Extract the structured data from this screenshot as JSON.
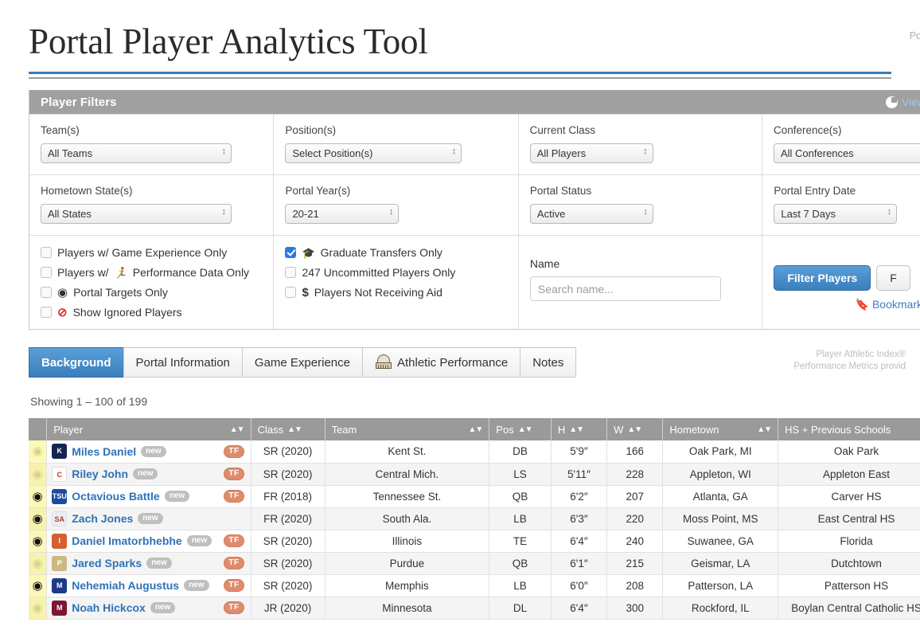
{
  "header": {
    "title": "Portal Player Analytics Tool",
    "powered_by": "Powe"
  },
  "filters": {
    "panel_title": "Player Filters",
    "view_link": "View",
    "view_icon": "pie-chart-icon",
    "fields": [
      {
        "label": "Team(s)",
        "value": "All Teams"
      },
      {
        "label": "Position(s)",
        "value": "Select Position(s)"
      },
      {
        "label": "Current Class",
        "value": "All Players"
      },
      {
        "label": "Conference(s)",
        "value": "All Conferences"
      },
      {
        "label": "Hometown State(s)",
        "value": "All States"
      },
      {
        "label": "Portal Year(s)",
        "value": "20-21"
      },
      {
        "label": "Portal Status",
        "value": "Active"
      },
      {
        "label": "Portal Entry Date",
        "value": "Last 7 Days"
      }
    ],
    "checkboxes_left": [
      {
        "label": "Players w/ Game Experience Only",
        "checked": false,
        "icon": ""
      },
      {
        "label": "Performance Data Only",
        "prefix": "Players w/",
        "checked": false,
        "icon": "ƒ",
        "icon_name": "running-figure-icon"
      },
      {
        "label": "Portal Targets Only",
        "checked": false,
        "icon": "◉",
        "icon_name": "target-icon"
      },
      {
        "label": "Show Ignored Players",
        "checked": false,
        "icon": "⊘",
        "icon_name": "prohibition-icon"
      }
    ],
    "checkboxes_mid": [
      {
        "label": "Graduate Transfers Only",
        "checked": true,
        "icon": "🎓",
        "icon_name": "graduation-cap-icon"
      },
      {
        "label": "247 Uncommitted Players Only",
        "checked": false,
        "icon": "",
        "icon_name": ""
      },
      {
        "label": "Players Not Receiving Aid",
        "checked": false,
        "icon": "$",
        "icon_name": "dollar-icon"
      }
    ],
    "name_label": "Name",
    "name_placeholder": "Search name...",
    "name_value": "",
    "filter_button": "Filter Players",
    "secondary_button": "F",
    "bookmark_label": "Bookmark",
    "bookmark_icon": "bookmark-icon",
    "accent_blue": "#3a7ebd",
    "panel_gray": "#a0a0a0"
  },
  "tabs": [
    {
      "label": "Background",
      "active": true,
      "icon": ""
    },
    {
      "label": "Portal Information",
      "active": false,
      "icon": ""
    },
    {
      "label": "Game Experience",
      "active": false,
      "icon": ""
    },
    {
      "label": "Athletic Performance",
      "active": false,
      "icon": "stadium-logo-icon"
    },
    {
      "label": "Notes",
      "active": false,
      "icon": ""
    }
  ],
  "pai_note": {
    "line1": "Player Athletic Index®",
    "line2": "Performance Metrics provid"
  },
  "results": {
    "showing": "Showing 1 – 100 of 199",
    "columns": [
      {
        "key": "target",
        "label": "",
        "sortable": false
      },
      {
        "key": "player",
        "label": "Player",
        "sortable": true
      },
      {
        "key": "class",
        "label": "Class",
        "sortable": true
      },
      {
        "key": "team",
        "label": "Team",
        "sortable": true
      },
      {
        "key": "pos",
        "label": "Pos",
        "sortable": true
      },
      {
        "key": "h",
        "label": "H",
        "sortable": true
      },
      {
        "key": "w",
        "label": "W",
        "sortable": true
      },
      {
        "key": "hometown",
        "label": "Hometown",
        "sortable": true
      },
      {
        "key": "hs",
        "label": "HS + Previous Schools",
        "sortable": false
      }
    ],
    "sort_glyph": "▲▼",
    "rows": [
      {
        "target": "dim",
        "name": "Miles Daniel",
        "new": "new",
        "tf": "TF",
        "logo_bg": "#11264f",
        "logo_text": "K",
        "class": "SR (2020)",
        "team": "Kent St.",
        "pos": "DB",
        "h": "5'9″",
        "w": "166",
        "hometown": "Oak Park, MI",
        "hs": "Oak Park"
      },
      {
        "target": "dim",
        "name": "Riley John",
        "new": "new",
        "tf": "TF",
        "logo_bg": "#ffffff",
        "logo_text": "C",
        "class": "SR (2020)",
        "team": "Central Mich.",
        "pos": "LS",
        "h": "5'11″",
        "w": "228",
        "hometown": "Appleton, WI",
        "hs": "Appleton East"
      },
      {
        "target": "on",
        "name": "Octavious Battle",
        "new": "new",
        "tf": "TF",
        "logo_bg": "#1c4a9e",
        "logo_text": "TSU",
        "class": "FR (2018)",
        "team": "Tennessee St.",
        "pos": "QB",
        "h": "6'2″",
        "w": "207",
        "hometown": "Atlanta, GA",
        "hs": "Carver HS"
      },
      {
        "target": "on",
        "name": "Zach Jones",
        "new": "new",
        "tf": "",
        "logo_bg": "#e9eef5",
        "logo_text": "SA",
        "class": "FR (2020)",
        "team": "South Ala.",
        "pos": "LB",
        "h": "6'3″",
        "w": "220",
        "hometown": "Moss Point, MS",
        "hs": "East Central HS"
      },
      {
        "target": "on",
        "name": "Daniel Imatorbhebhe",
        "new": "new",
        "tf": "TF",
        "logo_bg": "#d45f32",
        "logo_text": "I",
        "class": "SR (2020)",
        "team": "Illinois",
        "pos": "TE",
        "h": "6'4″",
        "w": "240",
        "hometown": "Suwanee, GA",
        "hs": "Florida"
      },
      {
        "target": "dim",
        "name": "Jared Sparks",
        "new": "new",
        "tf": "TF",
        "logo_bg": "#cdb87f",
        "logo_text": "P",
        "class": "SR (2020)",
        "team": "Purdue",
        "pos": "QB",
        "h": "6'1″",
        "w": "215",
        "hometown": "Geismar, LA",
        "hs": "Dutchtown"
      },
      {
        "target": "on",
        "name": "Nehemiah Augustus",
        "new": "new",
        "tf": "TF",
        "logo_bg": "#1d3a8a",
        "logo_text": "M",
        "class": "SR (2020)",
        "team": "Memphis",
        "pos": "LB",
        "h": "6'0″",
        "w": "208",
        "hometown": "Patterson, LA",
        "hs": "Patterson HS"
      },
      {
        "target": "dim",
        "name": "Noah Hickcox",
        "new": "new",
        "tf": "TF",
        "logo_bg": "#7c1432",
        "logo_text": "M",
        "class": "JR (2020)",
        "team": "Minnesota",
        "pos": "DL",
        "h": "6'4″",
        "w": "300",
        "hometown": "Rockford, IL",
        "hs": "Boylan Central Catholic HS"
      }
    ]
  }
}
